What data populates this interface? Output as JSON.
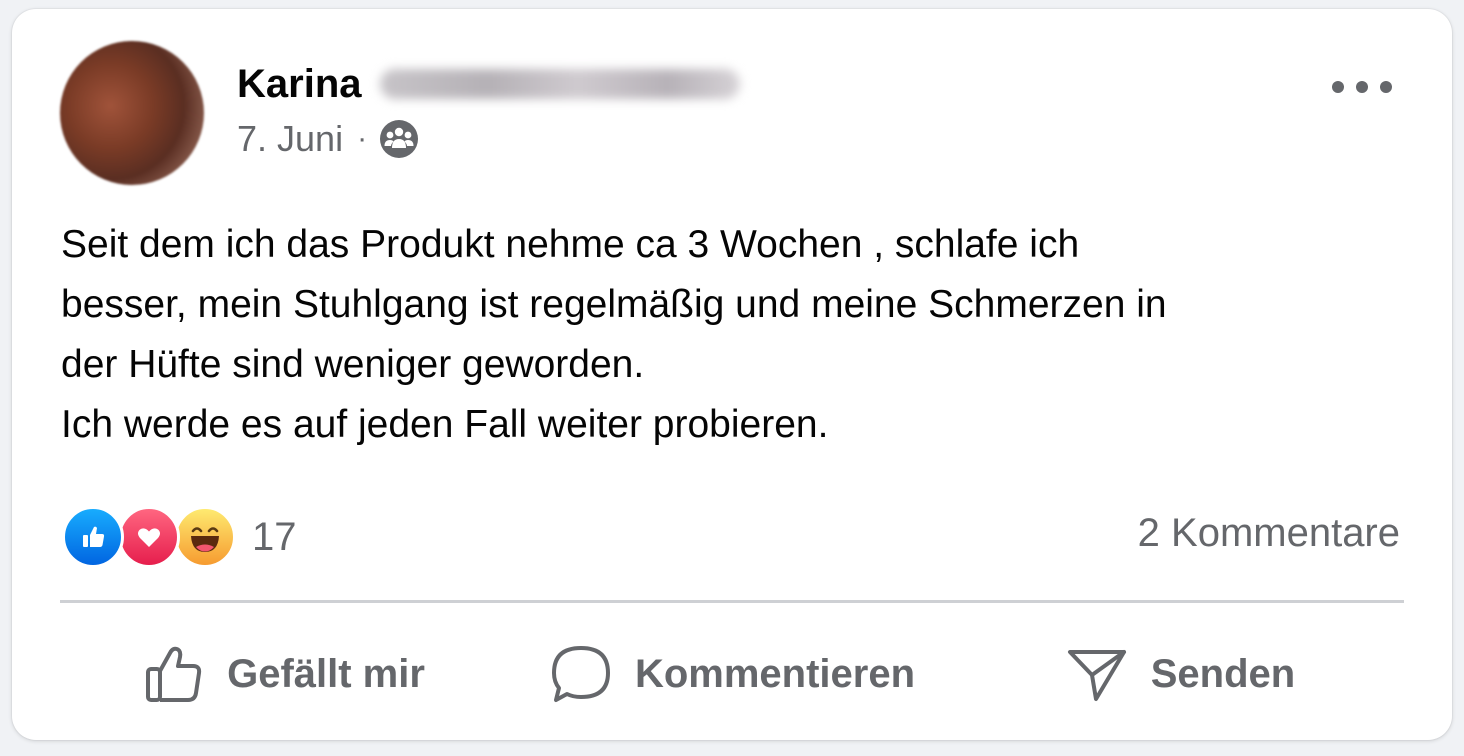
{
  "post": {
    "author_name": "Karina",
    "date": "7. Juni",
    "separator": "·",
    "audience_icon": "group-icon",
    "text": "Seit dem ich das Produkt nehme ca 3 Wochen , schlafe ich\nbesser, mein Stuhlgang ist regelmäßig und meine Schmerzen in\nder Hüfte sind weniger geworden.\nIch werde es auf jeden Fall weiter probieren."
  },
  "reactions": {
    "types": [
      "like-icon",
      "love-icon",
      "haha-icon"
    ],
    "count": "17"
  },
  "comments": {
    "count_label": "2 Kommentare"
  },
  "actions": {
    "like_label": "Gefällt mir",
    "comment_label": "Kommentieren",
    "send_label": "Senden"
  },
  "colors": {
    "text_primary": "#050505",
    "text_secondary": "#65676b",
    "like_blue": "#0866ff",
    "love_red": "#f33e58",
    "haha_yellow": "#f7b125",
    "divider": "#ced0d4"
  }
}
